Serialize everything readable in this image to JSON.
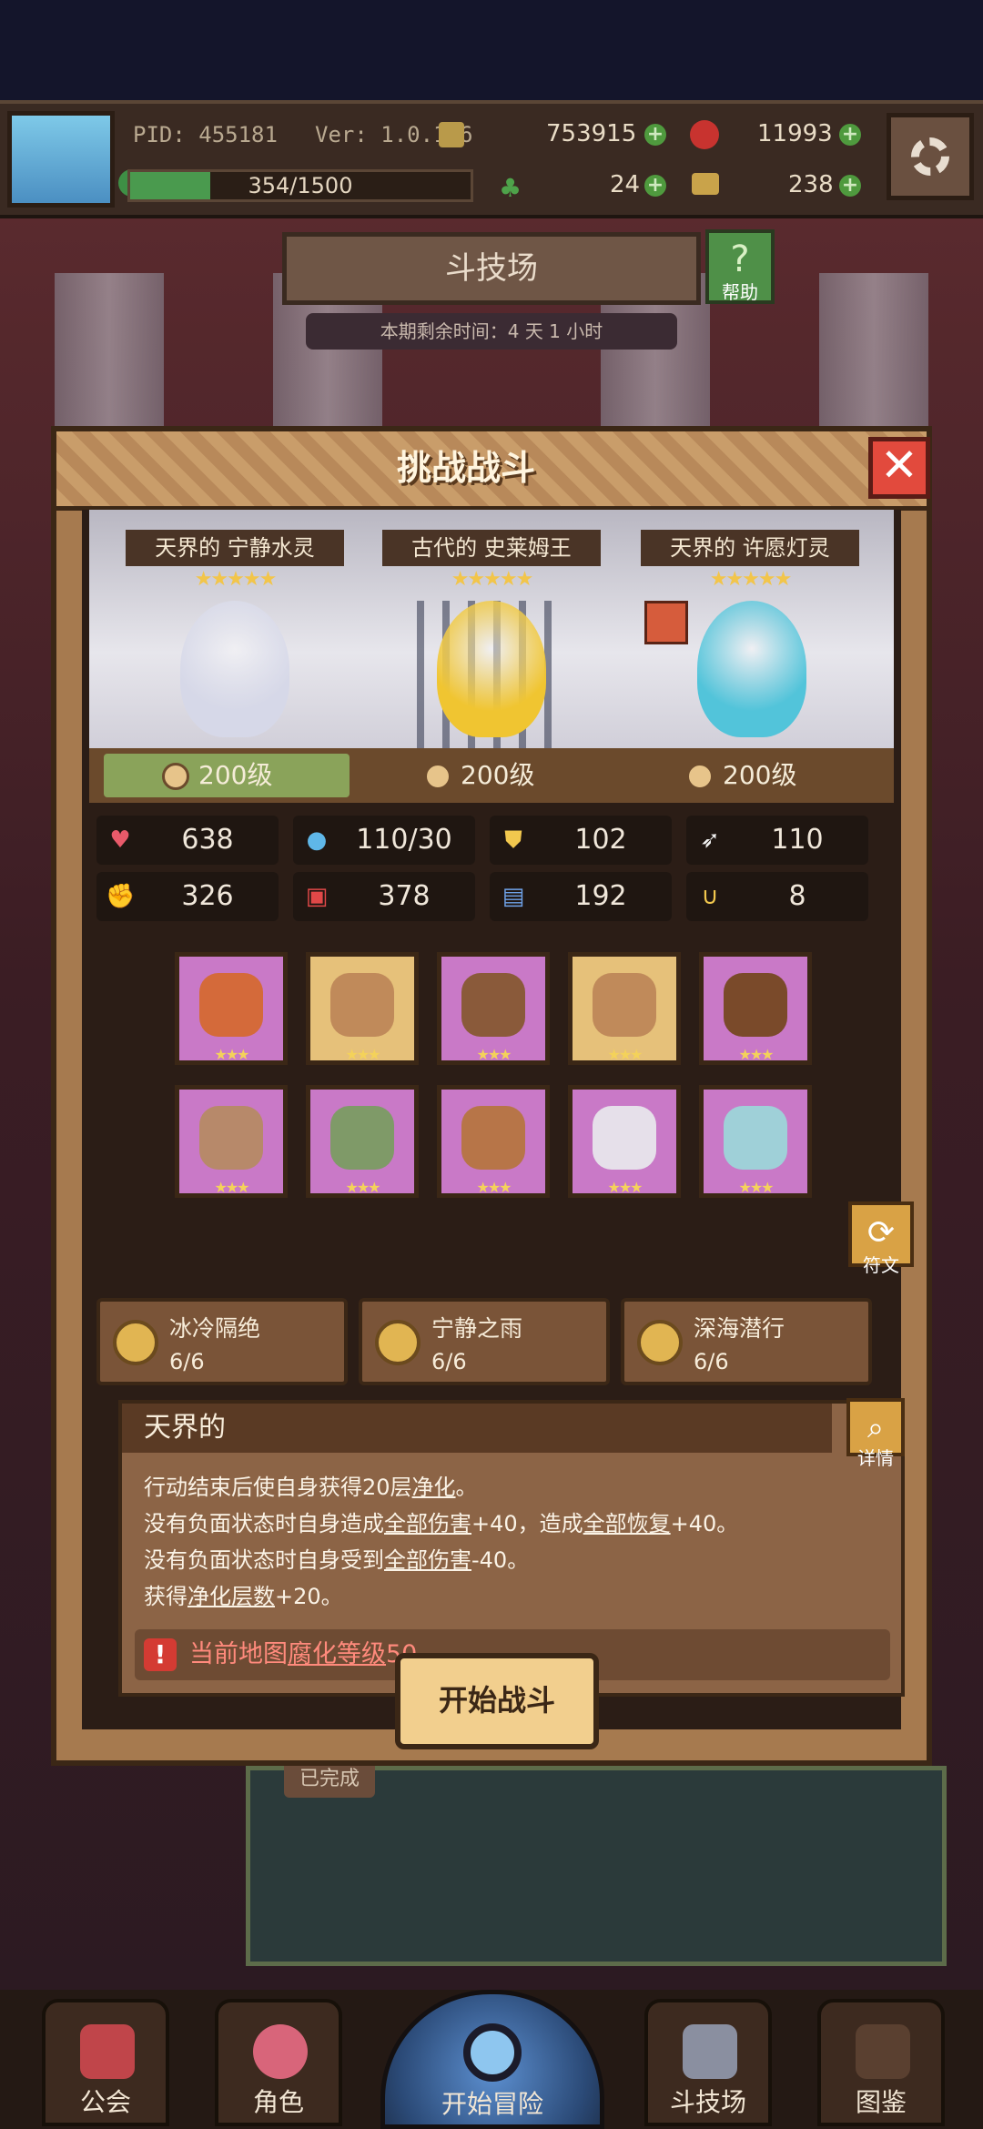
{
  "topbar": {
    "pid": "PID: 455181",
    "version": "Ver: 1.0.1.6",
    "gold": "753915",
    "gems": "11993",
    "exp_text": "354/1500",
    "exp_fraction": 0.236,
    "clover": "24",
    "keys": "238"
  },
  "arena": {
    "title": "斗技场",
    "help": "帮助",
    "remaining": "本期剩余时间：4 天 1 小时"
  },
  "modal": {
    "title": "挑战战斗",
    "close_icon": "close-icon",
    "heroes": [
      {
        "name": "天界的 宁静水灵",
        "stars": "★★★★★",
        "level": "200级",
        "color": "#d6d8e8"
      },
      {
        "name": "古代的 史莱姆王",
        "stars": "★★★★★",
        "level": "200级",
        "color": "#f0c531"
      },
      {
        "name": "天界的 许愿灯灵",
        "stars": "★★★★★",
        "level": "200级",
        "color": "#52c4da"
      }
    ],
    "stats": [
      {
        "icon": "heart-icon",
        "glyph": "♥",
        "color": "#e85a6a",
        "value": "638"
      },
      {
        "icon": "mana-drop-icon",
        "glyph": "●",
        "color": "#5fb7e8",
        "value": "110/30"
      },
      {
        "icon": "shield-icon",
        "glyph": "⛊",
        "color": "#f2c84e",
        "value": "102"
      },
      {
        "icon": "wing-icon",
        "glyph": "➶",
        "color": "#f3f3f3",
        "value": "110"
      },
      {
        "icon": "fist-icon",
        "glyph": "✊",
        "color": "#f0a08a",
        "value": "326"
      },
      {
        "icon": "spellbook-icon",
        "glyph": "▣",
        "color": "#e04848",
        "value": "378"
      },
      {
        "icon": "potion-scroll-icon",
        "glyph": "▤",
        "color": "#6fa2e8",
        "value": "192"
      },
      {
        "icon": "horseshoe-icon",
        "glyph": "∪",
        "color": "#f2c84e",
        "value": "8"
      }
    ],
    "equipment": [
      {
        "icon": "staff-icon",
        "rarity": "purple",
        "stars": "★★★",
        "color": "#d46a3a"
      },
      {
        "icon": "shell-icon",
        "rarity": "gold",
        "stars": "★★★",
        "color": "#c08a5a"
      },
      {
        "icon": "amulet-icon",
        "rarity": "purple",
        "stars": "★★★",
        "color": "#8a5a3a"
      },
      {
        "icon": "shell-icon",
        "rarity": "gold",
        "stars": "★★★",
        "color": "#c08a5a"
      },
      {
        "icon": "bag-icon",
        "rarity": "purple",
        "stars": "★★★",
        "color": "#7a4a2a"
      },
      {
        "icon": "bull-helmet-icon",
        "rarity": "purple",
        "stars": "★★★",
        "color": "#b7896a"
      },
      {
        "icon": "armor-icon",
        "rarity": "purple",
        "stars": "★★★",
        "color": "#7f9a68"
      },
      {
        "icon": "glove-icon",
        "rarity": "purple",
        "stars": "★★★",
        "color": "#b77548"
      },
      {
        "icon": "belt-icon",
        "rarity": "purple",
        "stars": "★★★",
        "color": "#e6e0ea"
      },
      {
        "icon": "boots-icon",
        "rarity": "purple",
        "stars": "★★★",
        "color": "#9fd0d8"
      }
    ],
    "rune_label": "符文",
    "sets": [
      {
        "name": "冰冷隔绝",
        "progress": "6/6"
      },
      {
        "name": "宁静之雨",
        "progress": "6/6"
      },
      {
        "name": "深海潜行",
        "progress": "6/6"
      }
    ],
    "trait": {
      "title": "天界的",
      "detail_label": "详情",
      "line1_a": "行动结束后使自身获得20层",
      "line1_u": "净化",
      "line1_b": "。",
      "line2_a": "没有负面状态时自身造成",
      "line2_u1": "全部伤害",
      "line2_b": "+40，造成",
      "line2_u2": "全部恢复",
      "line2_c": "+40。",
      "line3_a": "没有负面状态时自身受到",
      "line3_u": "全部伤害",
      "line3_b": "-40。",
      "line4_a": "获得",
      "line4_u": "净化层数",
      "line4_b": "+20。",
      "warning_a": "当前地图",
      "warning_u": "腐化等级",
      "warning_b": "50"
    },
    "start_button": "开始战斗"
  },
  "background": {
    "done_tag": "已完成"
  },
  "nav": {
    "guild": "公会",
    "character": "角色",
    "adventure": "开始冒险",
    "arena": "斗技场",
    "codex": "图鉴"
  }
}
